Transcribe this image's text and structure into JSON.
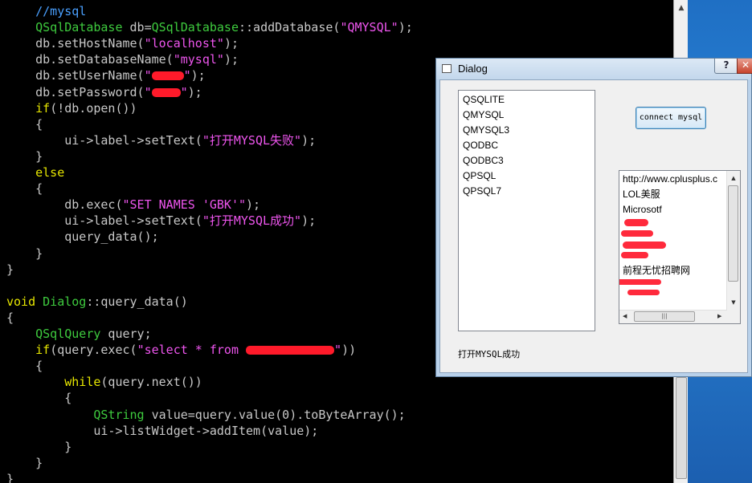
{
  "editor": {
    "lines": [
      [
        "    ",
        {
          "t": "cm",
          "v": "//mysql"
        }
      ],
      [
        "    ",
        {
          "t": "type",
          "v": "QSqlDatabase"
        },
        " db=",
        {
          "t": "type",
          "v": "QSqlDatabase"
        },
        "::addDatabase(",
        {
          "t": "str",
          "v": "\"QMYSQL\""
        },
        ");"
      ],
      [
        "    db.setHostName(",
        {
          "t": "str",
          "v": "\"localhost\""
        },
        ");"
      ],
      [
        "    db.setDatabaseName(",
        {
          "t": "str",
          "v": "\"mysql\""
        },
        ");"
      ],
      [
        "    db.setUserName(",
        {
          "t": "str",
          "v": "\""
        },
        {
          "t": "redact",
          "w": 40
        },
        {
          "t": "str",
          "v": "\""
        },
        ");"
      ],
      [
        "    db.setPassword(",
        {
          "t": "str",
          "v": "\""
        },
        {
          "t": "redact",
          "w": 36
        },
        {
          "t": "str",
          "v": "\""
        },
        ");"
      ],
      [
        "    ",
        {
          "t": "kw",
          "v": "if"
        },
        "(!db.open())"
      ],
      [
        "    {"
      ],
      [
        "        ui->label->setText(",
        {
          "t": "str",
          "v": "\"打开MYSQL失败\""
        },
        ");"
      ],
      [
        "    }"
      ],
      [
        "    ",
        {
          "t": "kw",
          "v": "else"
        }
      ],
      [
        "    {"
      ],
      [
        "        db.exec(",
        {
          "t": "str",
          "v": "\"SET NAMES 'GBK'\""
        },
        ");"
      ],
      [
        "        ui->label->setText(",
        {
          "t": "str",
          "v": "\"打开MYSQL成功\""
        },
        ");"
      ],
      [
        "        query_data();"
      ],
      [
        "    }"
      ],
      [
        "}"
      ],
      [
        ""
      ],
      [
        {
          "t": "kw",
          "v": "void"
        },
        " ",
        {
          "t": "type",
          "v": "Dialog"
        },
        "::query_data()"
      ],
      [
        "{"
      ],
      [
        "    ",
        {
          "t": "type",
          "v": "QSqlQuery"
        },
        " query;"
      ],
      [
        "    ",
        {
          "t": "kw",
          "v": "if"
        },
        "(query.exec(",
        {
          "t": "str",
          "v": "\"select * from "
        },
        {
          "t": "redact",
          "w": 110
        },
        {
          "t": "str",
          "v": "\""
        },
        "))"
      ],
      [
        "    {"
      ],
      [
        "        ",
        {
          "t": "kw",
          "v": "while"
        },
        "(query.next())"
      ],
      [
        "        {"
      ],
      [
        "            ",
        {
          "t": "type",
          "v": "QString"
        },
        " value=query.value(0).toByteArray();"
      ],
      [
        "            ui->listWidget->addItem(value);"
      ],
      [
        "        }"
      ],
      [
        "    }"
      ],
      [
        "}"
      ]
    ]
  },
  "dialog": {
    "title": "Dialog",
    "help_glyph": "?",
    "close_glyph": "✕",
    "drivers": [
      "QSQLITE",
      "QMYSQL",
      "QMYSQL3",
      "QODBC",
      "QODBC3",
      "QPSQL",
      "QPSQL7"
    ],
    "connect_label": "connect mysql",
    "results": [
      "http://www.cplusplus.c",
      "LOL美服",
      "Microsotf",
      "",
      "",
      "",
      "前程无忧招聘网"
    ],
    "status": "打开MYSQL成功"
  },
  "colors": {
    "keyword": "#e6e600",
    "type": "#3ecb3e",
    "string": "#ee55ee",
    "comment": "#4aa0ff",
    "redaction": "#ff1a2a"
  }
}
